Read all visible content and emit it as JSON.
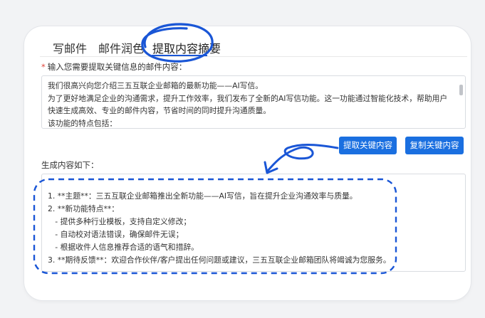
{
  "tabs": [
    {
      "label": "写邮件"
    },
    {
      "label": "邮件润色"
    },
    {
      "label": "提取内容摘要"
    }
  ],
  "active_tab": 2,
  "prompt": {
    "required_mark": "*",
    "label": "输入您需要提取关键信息的邮件内容："
  },
  "email_content": {
    "lines": [
      "我们很高兴向您介绍三五互联企业邮箱的最新功能——AI写信。",
      "为了更好地满足企业的沟通需求，提升工作效率，我们发布了全新的AI写信功能。这一功能通过智能化技术，帮助用户",
      "快速生成高效、专业的邮件内容，节省时间的同时提升沟通质量。",
      "该功能的特点包括："
    ]
  },
  "buttons": {
    "extract": "提取关键内容",
    "copy": "复制关键内容"
  },
  "result": {
    "label": "生成内容如下：",
    "lines": [
      "1. **主题**：三五互联企业邮箱推出全新功能——AI写信，旨在提升企业沟通效率与质量。",
      "2. **新功能特点**：",
      "   - 提供多种行业模板，支持自定义修改；",
      "   - 自动校对语法错误，确保邮件无误；",
      "   - 根据收件人信息推荐合适的语气和措辞。",
      "3. **期待反馈**：欢迎合作伙伴/客户提出任何问题或建议，三五互联企业邮箱团队将竭诚为您服务。"
    ]
  },
  "colors": {
    "accent": "#1a6fe0",
    "annotation": "#1a56d6",
    "required": "#e0443a"
  }
}
